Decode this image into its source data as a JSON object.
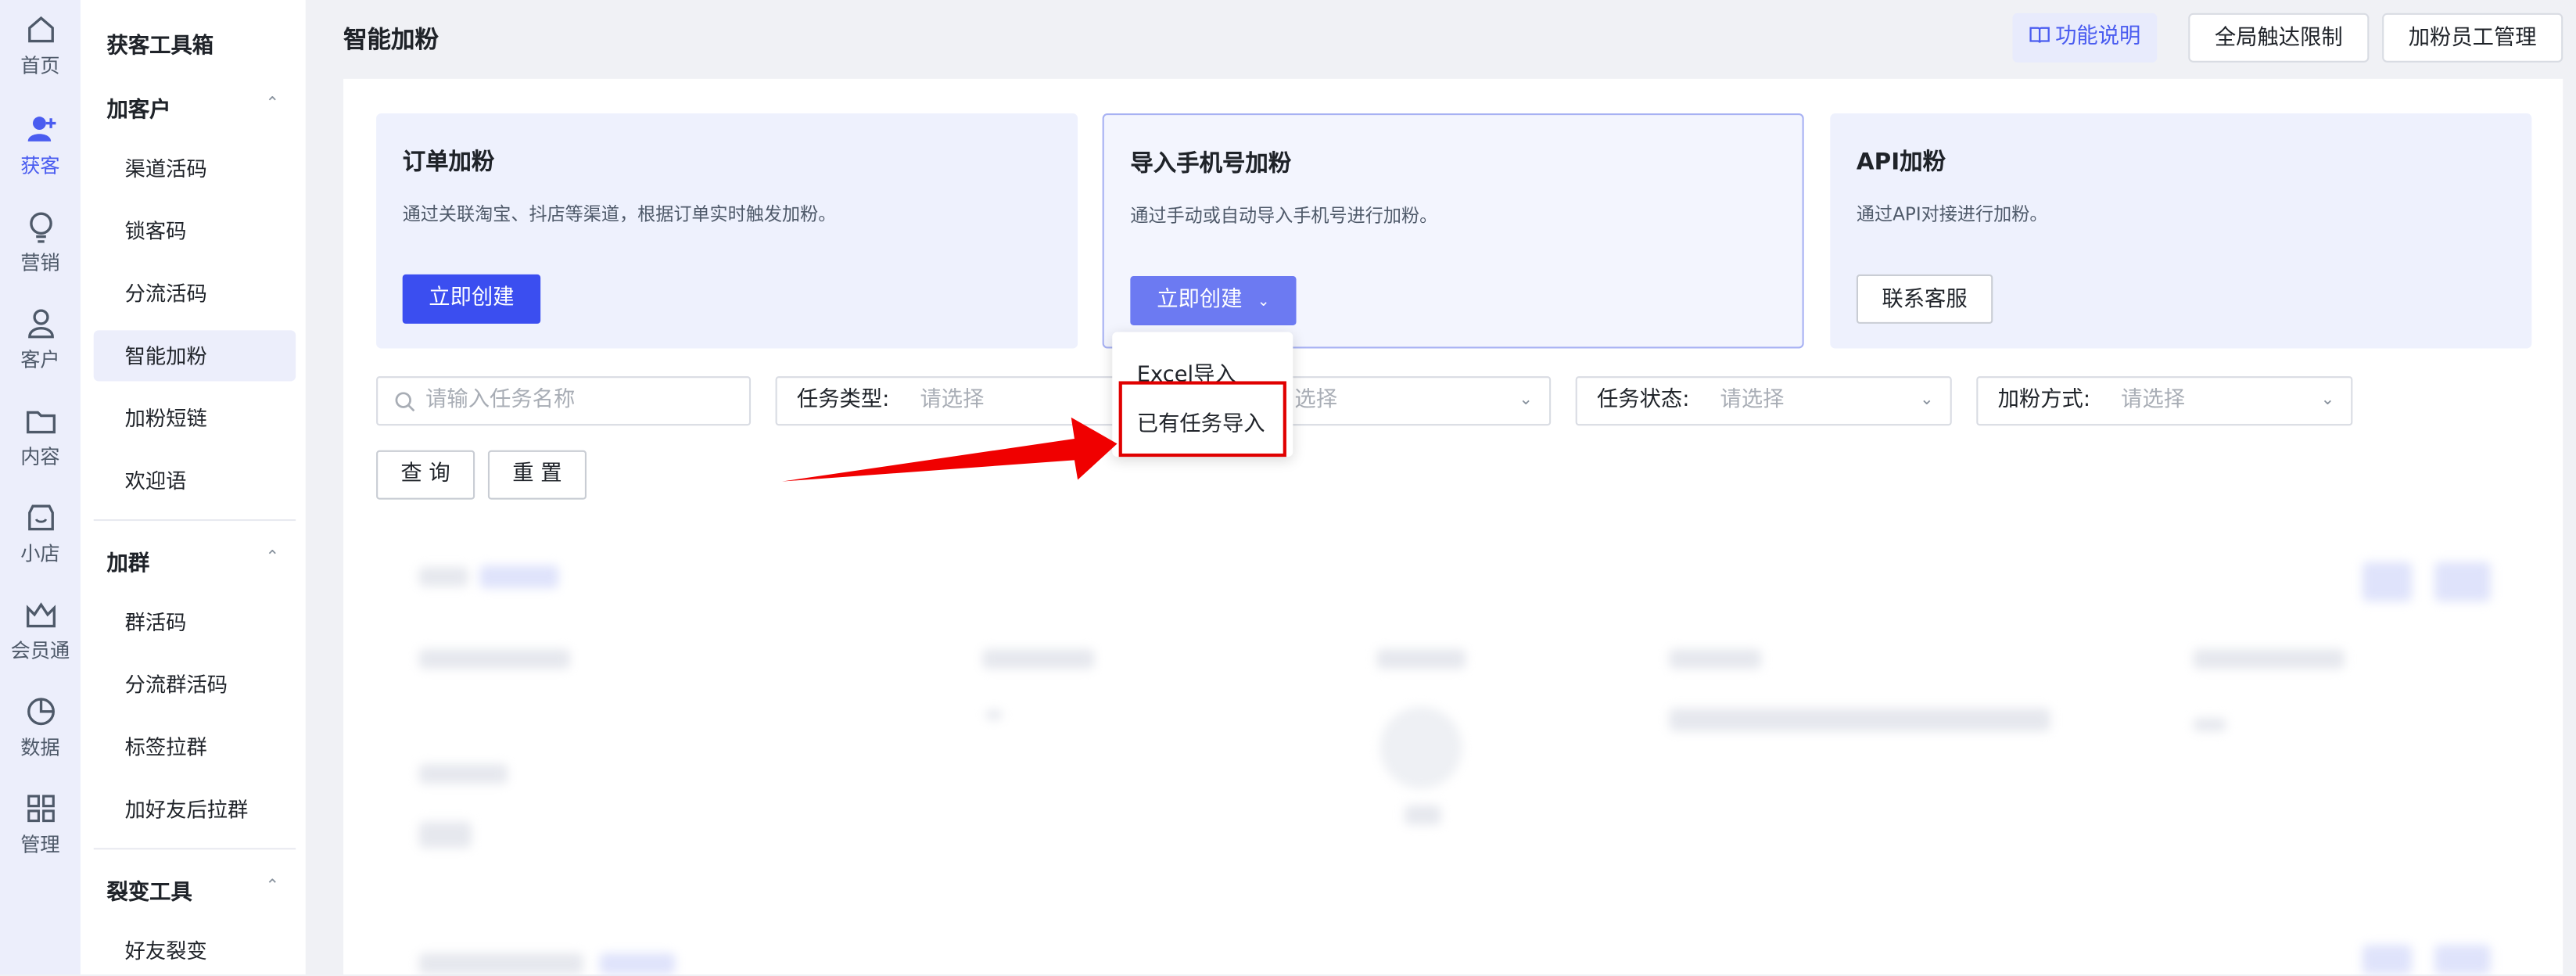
{
  "rail": {
    "items": [
      {
        "label": "首页",
        "icon": "home-icon"
      },
      {
        "label": "获客",
        "icon": "user-add-icon"
      },
      {
        "label": "营销",
        "icon": "bulb-icon"
      },
      {
        "label": "客户",
        "icon": "user-icon"
      },
      {
        "label": "内容",
        "icon": "folder-icon"
      },
      {
        "label": "小店",
        "icon": "shop-icon"
      },
      {
        "label": "会员通",
        "icon": "crown-icon"
      },
      {
        "label": "数据",
        "icon": "pie-chart-icon"
      },
      {
        "label": "管理",
        "icon": "grid-icon"
      }
    ],
    "active": "获客"
  },
  "sidebar": {
    "title": "获客工具箱",
    "groups": [
      {
        "label": "加客户",
        "items": [
          "渠道活码",
          "锁客码",
          "分流活码",
          "智能加粉",
          "加粉短链",
          "欢迎语"
        ]
      },
      {
        "label": "加群",
        "items": [
          "群活码",
          "分流群活码",
          "标签拉群",
          "加好友后拉群"
        ]
      },
      {
        "label": "裂变工具",
        "items": [
          "好友裂变"
        ]
      }
    ],
    "active_item": "智能加粉"
  },
  "header": {
    "title": "智能加粉",
    "help_label": "功能说明",
    "limit_label": "全局触达限制",
    "staff_label": "加粉员工管理"
  },
  "cards": [
    {
      "title": "订单加粉",
      "desc": "通过关联淘宝、抖店等渠道，根据订单实时触发加粉。",
      "button": "立即创建"
    },
    {
      "title": "导入手机号加粉",
      "desc": "通过手动或自动导入手机号进行加粉。",
      "button": "立即创建"
    },
    {
      "title": "API加粉",
      "desc": "通过API对接进行加粉。",
      "button": "联系客服"
    }
  ],
  "dropdown": {
    "items": [
      "Excel导入",
      "已有任务导入"
    ],
    "highlighted": "已有任务导入"
  },
  "filters": {
    "search_placeholder": "请输入任务名称",
    "task_type_label": "任务类型:",
    "placeholder": "请选择",
    "partial_placeholder": "选择",
    "task_status_label": "任务状态:",
    "add_method_label": "加粉方式:"
  },
  "actions": {
    "query_label": "查 询",
    "reset_label": "重 置"
  },
  "colors": {
    "primary": "#3b4ef0",
    "highlight_border": "#e00000",
    "arrow": "#f00000"
  }
}
